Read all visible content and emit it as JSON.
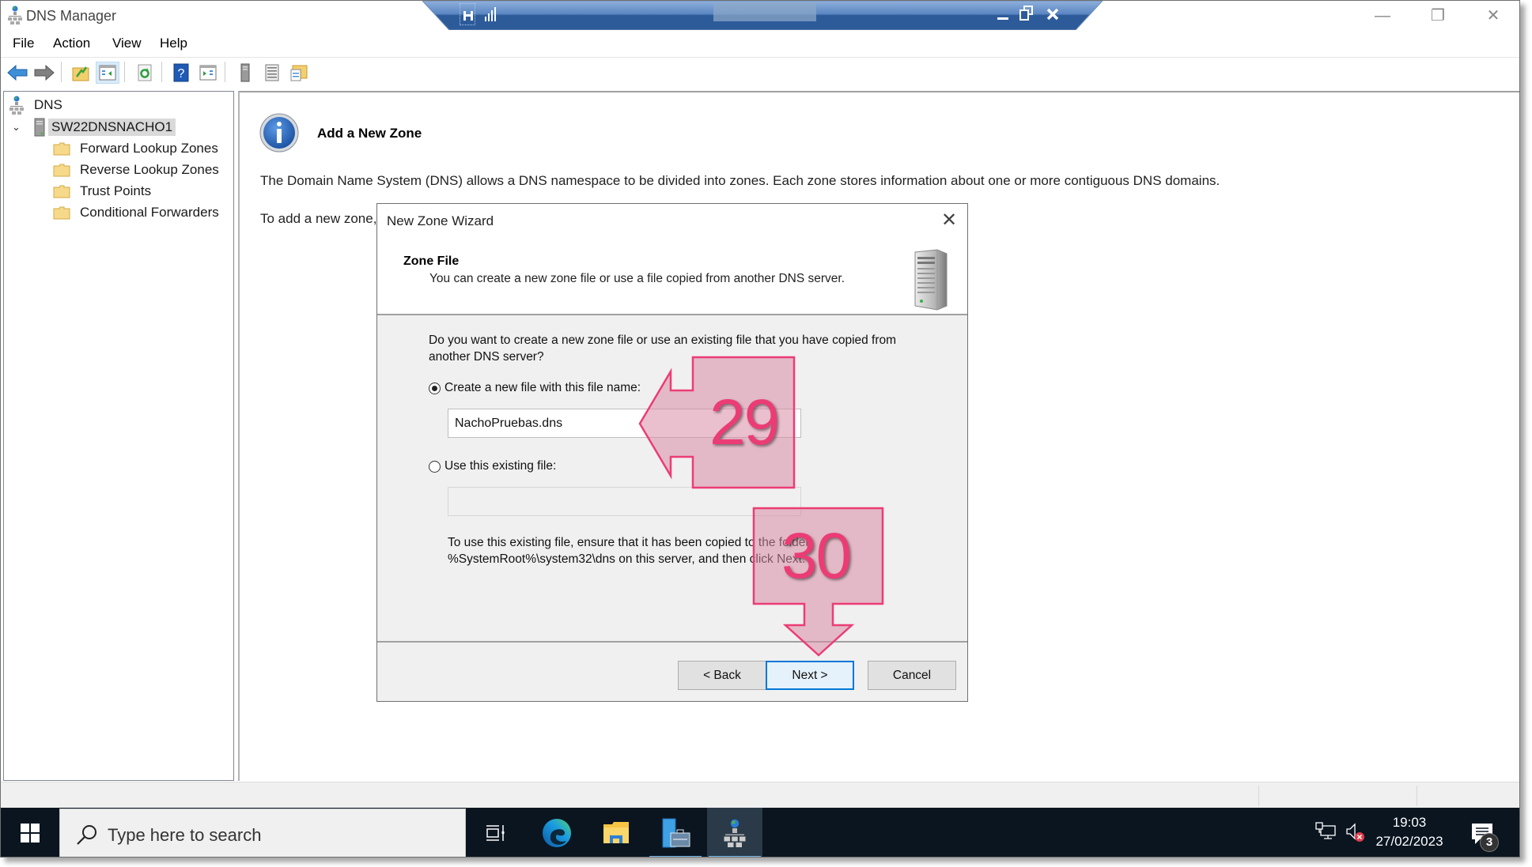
{
  "window": {
    "title": "DNS Manager",
    "controls": {
      "minimize": "—",
      "restore": "❐",
      "close": "✕"
    }
  },
  "remote_bar": {
    "pin_icon": "pin-icon",
    "signal_icon": "connection-signal-icon",
    "controls": {
      "minimize": "minimize-icon",
      "restore": "restore-icon",
      "close": "close-icon"
    }
  },
  "menu": [
    "File",
    "Action",
    "View",
    "Help"
  ],
  "toolbar": [
    {
      "name": "back-button",
      "icon": "arrow-left-icon"
    },
    {
      "name": "forward-button",
      "icon": "arrow-right-icon"
    },
    {
      "name": "up-one-level-button",
      "icon": "folder-up-icon"
    },
    {
      "name": "show-hide-console-tree-button",
      "icon": "console-tree-icon"
    },
    {
      "name": "refresh-button",
      "icon": "refresh-icon"
    },
    {
      "name": "help-button",
      "icon": "help-icon"
    },
    {
      "name": "show-hide-action-pane-button",
      "icon": "action-pane-icon"
    },
    {
      "name": "server-button",
      "icon": "server-icon"
    },
    {
      "name": "list-button",
      "icon": "list-icon"
    },
    {
      "name": "properties-button",
      "icon": "properties-icon"
    }
  ],
  "tree": {
    "root": "DNS",
    "server": "SW22DNSNACHO1",
    "children": [
      "Forward Lookup Zones",
      "Reverse Lookup Zones",
      "Trust Points",
      "Conditional Forwarders"
    ]
  },
  "main": {
    "heading": "Add a New Zone",
    "description": "The Domain Name System (DNS) allows a DNS namespace to be divided into zones. Each zone stores information about one or more contiguous DNS domains.",
    "add_text": "To add a new zone,"
  },
  "dialog": {
    "title": "New Zone Wizard",
    "close": "✕",
    "header_title": "Zone File",
    "header_subtitle": "You can create a new zone file or use a file copied from another DNS server.",
    "question": "Do you want to create a new zone file or use an existing file that you have copied from another DNS server?",
    "option_new": {
      "label": "Create a new file with this file name:",
      "selected": true,
      "value": "NachoPruebas.dns"
    },
    "option_existing": {
      "label": "Use this existing file:",
      "selected": false,
      "value": ""
    },
    "note": "To use this existing file, ensure that it has been copied to the folder %SystemRoot%\\system32\\dns on this server, and then click Next.",
    "buttons": {
      "back": "< Back",
      "next": "Next >",
      "cancel": "Cancel"
    }
  },
  "annotations": [
    {
      "number": "29",
      "points_to": "file-name-input",
      "direction": "left"
    },
    {
      "number": "30",
      "points_to": "next-button",
      "direction": "down"
    }
  ],
  "annotation_color": "#ec3c75",
  "taskbar": {
    "search_placeholder": "Type here to search",
    "apps": [
      "task-view",
      "edge",
      "file-explorer",
      "server-manager",
      "dns-manager"
    ],
    "time": "19:03",
    "date": "27/02/2023",
    "notification_count": "3"
  }
}
